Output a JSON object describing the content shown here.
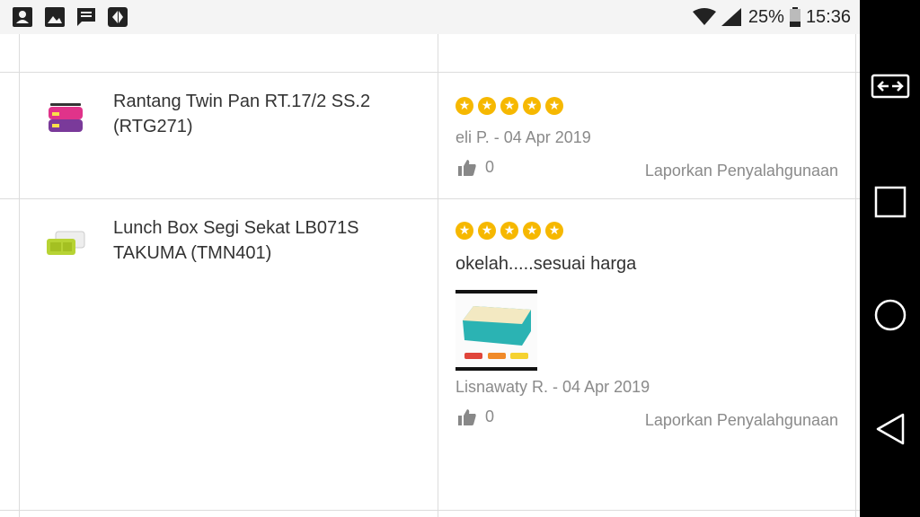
{
  "status_bar": {
    "battery": "25%",
    "time": "15:36",
    "icons": [
      "contact-icon",
      "image-icon",
      "message-icon",
      "app-icon",
      "wifi-icon",
      "signal-icon",
      "battery-icon"
    ]
  },
  "reviews": [
    {
      "product_name": "Rantang Twin Pan RT.17/2 SS.2 (RTG271)",
      "rating": 5,
      "review_text": "",
      "reviewer": "eli P. - 04 Apr 2019",
      "likes": "0",
      "report_label": "Laporkan Penyalahgunaan"
    },
    {
      "product_name": "Lunch Box Segi Sekat LB071S TAKUMA (TMN401)",
      "rating": 5,
      "review_text": "okelah.....sesuai harga",
      "reviewer": "Lisnawaty R. - 04 Apr 2019",
      "likes": "0",
      "report_label": "Laporkan Penyalahgunaan"
    }
  ],
  "colors": {
    "star": "#f6b800",
    "muted_text": "#8a8a8a",
    "divider": "#dcdcdc",
    "nav_bar": "#000000"
  },
  "nav_bar": {
    "buttons": [
      "screen-switch-icon",
      "recents-icon",
      "home-icon",
      "back-icon"
    ]
  }
}
